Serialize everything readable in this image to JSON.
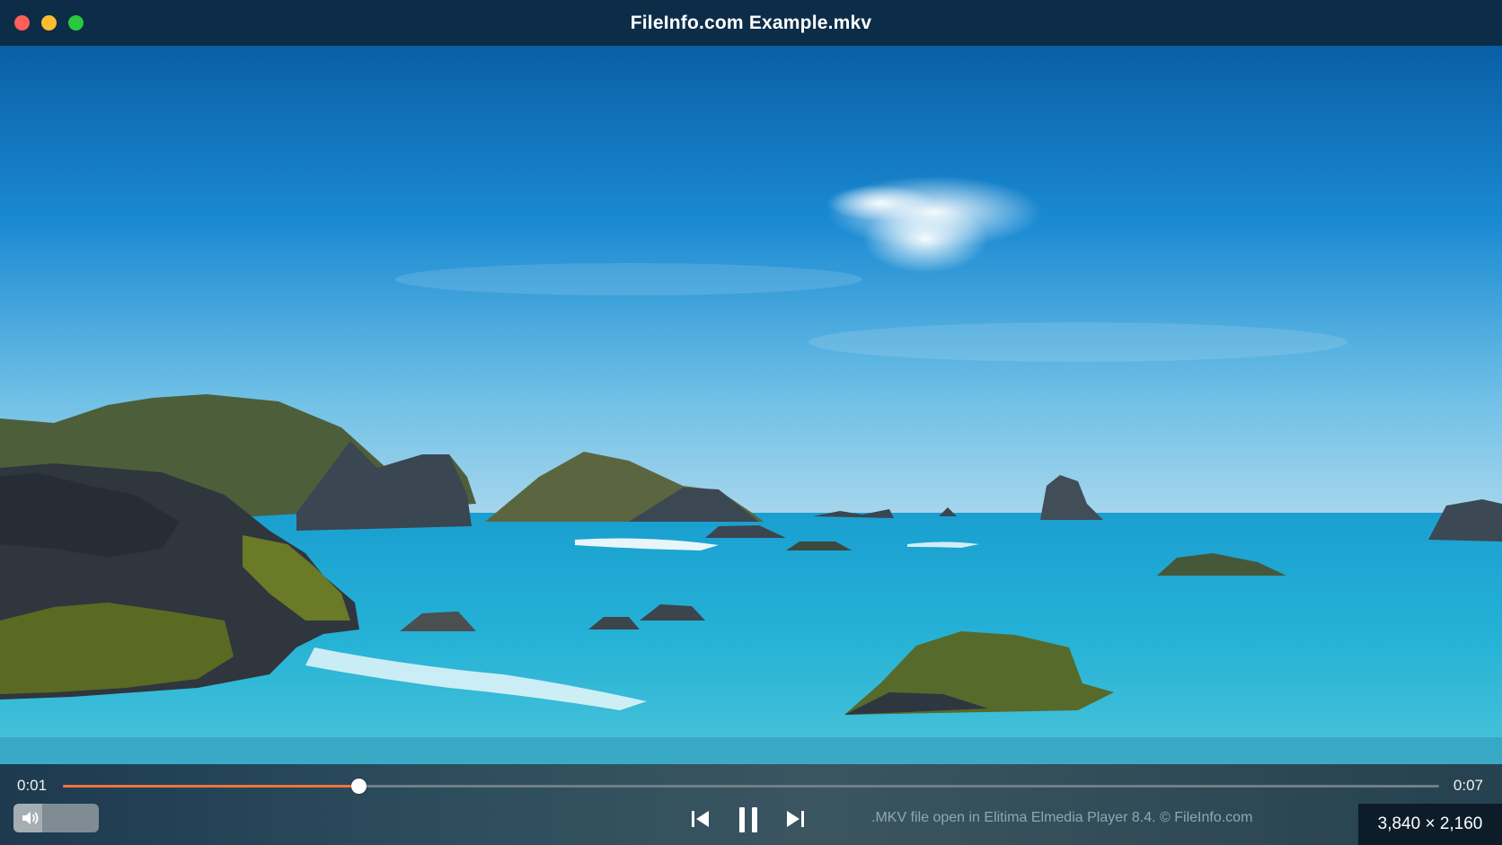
{
  "window": {
    "title": "FileInfo.com Example.mkv"
  },
  "colors": {
    "close": "#fe5f57",
    "minimize": "#febc2e",
    "maximize": "#28c840",
    "progress": "#f0733e"
  },
  "player": {
    "current_time": "0:01",
    "duration": "0:07",
    "progress_fraction": 0.215,
    "volume_fraction": 0.34,
    "caption": ".MKV file open in Elitima Elmedia Player 8.4. © FileInfo.com",
    "resolution": "3,840 × 2,160"
  },
  "icons": {
    "volume": "speaker-icon",
    "previous": "skip-back-icon",
    "pause": "pause-icon",
    "next": "skip-forward-icon"
  }
}
